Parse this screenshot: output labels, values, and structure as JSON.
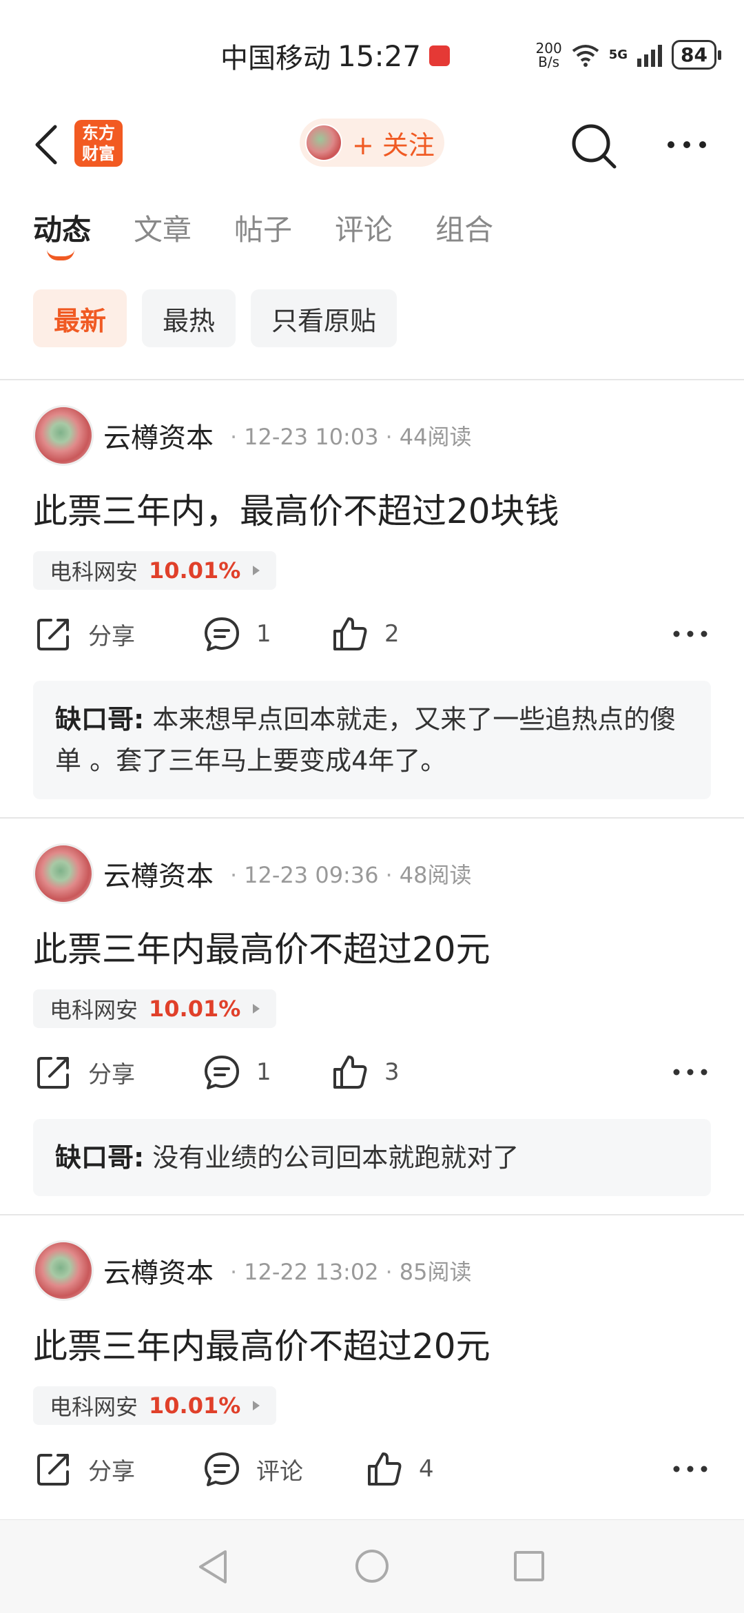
{
  "status_bar": {
    "carrier": "中国移动",
    "time": "15:27",
    "net_speed_value": "200",
    "net_speed_unit": "B/s",
    "network": "5G",
    "battery": "84"
  },
  "header": {
    "logo_text": "东方财富",
    "follow_label": "+ 关注"
  },
  "tabs": [
    {
      "label": "动态",
      "active": true
    },
    {
      "label": "文章",
      "active": false
    },
    {
      "label": "帖子",
      "active": false
    },
    {
      "label": "评论",
      "active": false
    },
    {
      "label": "组合",
      "active": false
    }
  ],
  "filters": [
    {
      "label": "最新",
      "active": true
    },
    {
      "label": "最热",
      "active": false
    },
    {
      "label": "只看原贴",
      "active": false
    }
  ],
  "posts": [
    {
      "username": "云樽资本",
      "time": "12-23 10:03",
      "reads": "44阅读",
      "title": "此票三年内，最高价不超过20块钱",
      "stock_name": "电科网安",
      "stock_change": "10.01%",
      "share_label": "分享",
      "comment_count": "1",
      "like_count": "2",
      "reply_author": "缺口哥:",
      "reply_text": "本来想早点回本就走，又来了一些追热点的傻 单 。套了三年马上要变成4年了。"
    },
    {
      "username": "云樽资本",
      "time": "12-23 09:36",
      "reads": "48阅读",
      "title": "此票三年内最高价不超过20元",
      "stock_name": "电科网安",
      "stock_change": "10.01%",
      "share_label": "分享",
      "comment_count": "1",
      "like_count": "3",
      "reply_author": "缺口哥:",
      "reply_text": "没有业绩的公司回本就跑就对了"
    },
    {
      "username": "云樽资本",
      "time": "12-22 13:02",
      "reads": "85阅读",
      "title": "此票三年内最高价不超过20元",
      "stock_name": "电科网安",
      "stock_change": "10.01%",
      "share_label": "分享",
      "comment_count": "评论",
      "like_count": "4"
    }
  ]
}
